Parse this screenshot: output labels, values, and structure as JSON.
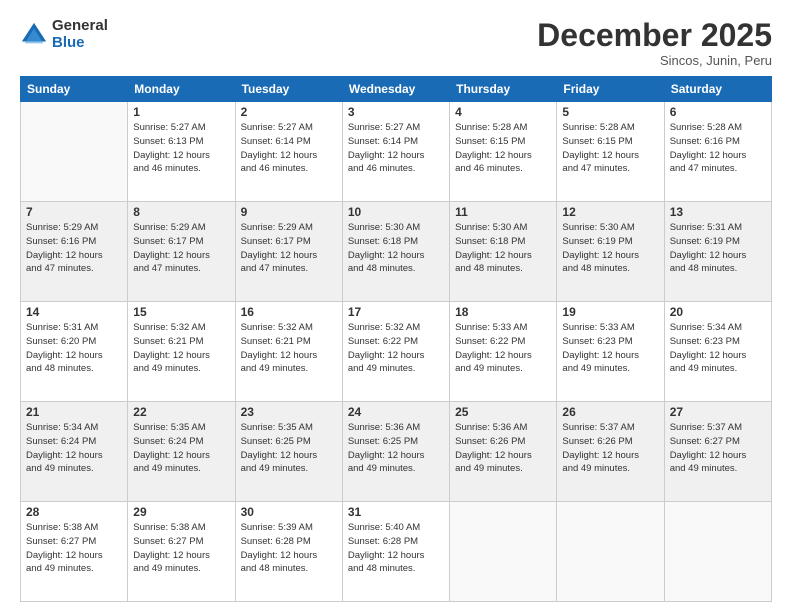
{
  "logo": {
    "general": "General",
    "blue": "Blue"
  },
  "title": "December 2025",
  "subtitle": "Sincos, Junin, Peru",
  "headers": [
    "Sunday",
    "Monday",
    "Tuesday",
    "Wednesday",
    "Thursday",
    "Friday",
    "Saturday"
  ],
  "weeks": [
    [
      {
        "day": "",
        "info": ""
      },
      {
        "day": "1",
        "info": "Sunrise: 5:27 AM\nSunset: 6:13 PM\nDaylight: 12 hours\nand 46 minutes."
      },
      {
        "day": "2",
        "info": "Sunrise: 5:27 AM\nSunset: 6:14 PM\nDaylight: 12 hours\nand 46 minutes."
      },
      {
        "day": "3",
        "info": "Sunrise: 5:27 AM\nSunset: 6:14 PM\nDaylight: 12 hours\nand 46 minutes."
      },
      {
        "day": "4",
        "info": "Sunrise: 5:28 AM\nSunset: 6:15 PM\nDaylight: 12 hours\nand 46 minutes."
      },
      {
        "day": "5",
        "info": "Sunrise: 5:28 AM\nSunset: 6:15 PM\nDaylight: 12 hours\nand 47 minutes."
      },
      {
        "day": "6",
        "info": "Sunrise: 5:28 AM\nSunset: 6:16 PM\nDaylight: 12 hours\nand 47 minutes."
      }
    ],
    [
      {
        "day": "7",
        "info": "Sunrise: 5:29 AM\nSunset: 6:16 PM\nDaylight: 12 hours\nand 47 minutes."
      },
      {
        "day": "8",
        "info": "Sunrise: 5:29 AM\nSunset: 6:17 PM\nDaylight: 12 hours\nand 47 minutes."
      },
      {
        "day": "9",
        "info": "Sunrise: 5:29 AM\nSunset: 6:17 PM\nDaylight: 12 hours\nand 47 minutes."
      },
      {
        "day": "10",
        "info": "Sunrise: 5:30 AM\nSunset: 6:18 PM\nDaylight: 12 hours\nand 48 minutes."
      },
      {
        "day": "11",
        "info": "Sunrise: 5:30 AM\nSunset: 6:18 PM\nDaylight: 12 hours\nand 48 minutes."
      },
      {
        "day": "12",
        "info": "Sunrise: 5:30 AM\nSunset: 6:19 PM\nDaylight: 12 hours\nand 48 minutes."
      },
      {
        "day": "13",
        "info": "Sunrise: 5:31 AM\nSunset: 6:19 PM\nDaylight: 12 hours\nand 48 minutes."
      }
    ],
    [
      {
        "day": "14",
        "info": "Sunrise: 5:31 AM\nSunset: 6:20 PM\nDaylight: 12 hours\nand 48 minutes."
      },
      {
        "day": "15",
        "info": "Sunrise: 5:32 AM\nSunset: 6:21 PM\nDaylight: 12 hours\nand 49 minutes."
      },
      {
        "day": "16",
        "info": "Sunrise: 5:32 AM\nSunset: 6:21 PM\nDaylight: 12 hours\nand 49 minutes."
      },
      {
        "day": "17",
        "info": "Sunrise: 5:32 AM\nSunset: 6:22 PM\nDaylight: 12 hours\nand 49 minutes."
      },
      {
        "day": "18",
        "info": "Sunrise: 5:33 AM\nSunset: 6:22 PM\nDaylight: 12 hours\nand 49 minutes."
      },
      {
        "day": "19",
        "info": "Sunrise: 5:33 AM\nSunset: 6:23 PM\nDaylight: 12 hours\nand 49 minutes."
      },
      {
        "day": "20",
        "info": "Sunrise: 5:34 AM\nSunset: 6:23 PM\nDaylight: 12 hours\nand 49 minutes."
      }
    ],
    [
      {
        "day": "21",
        "info": "Sunrise: 5:34 AM\nSunset: 6:24 PM\nDaylight: 12 hours\nand 49 minutes."
      },
      {
        "day": "22",
        "info": "Sunrise: 5:35 AM\nSunset: 6:24 PM\nDaylight: 12 hours\nand 49 minutes."
      },
      {
        "day": "23",
        "info": "Sunrise: 5:35 AM\nSunset: 6:25 PM\nDaylight: 12 hours\nand 49 minutes."
      },
      {
        "day": "24",
        "info": "Sunrise: 5:36 AM\nSunset: 6:25 PM\nDaylight: 12 hours\nand 49 minutes."
      },
      {
        "day": "25",
        "info": "Sunrise: 5:36 AM\nSunset: 6:26 PM\nDaylight: 12 hours\nand 49 minutes."
      },
      {
        "day": "26",
        "info": "Sunrise: 5:37 AM\nSunset: 6:26 PM\nDaylight: 12 hours\nand 49 minutes."
      },
      {
        "day": "27",
        "info": "Sunrise: 5:37 AM\nSunset: 6:27 PM\nDaylight: 12 hours\nand 49 minutes."
      }
    ],
    [
      {
        "day": "28",
        "info": "Sunrise: 5:38 AM\nSunset: 6:27 PM\nDaylight: 12 hours\nand 49 minutes."
      },
      {
        "day": "29",
        "info": "Sunrise: 5:38 AM\nSunset: 6:27 PM\nDaylight: 12 hours\nand 49 minutes."
      },
      {
        "day": "30",
        "info": "Sunrise: 5:39 AM\nSunset: 6:28 PM\nDaylight: 12 hours\nand 48 minutes."
      },
      {
        "day": "31",
        "info": "Sunrise: 5:40 AM\nSunset: 6:28 PM\nDaylight: 12 hours\nand 48 minutes."
      },
      {
        "day": "",
        "info": ""
      },
      {
        "day": "",
        "info": ""
      },
      {
        "day": "",
        "info": ""
      }
    ]
  ]
}
